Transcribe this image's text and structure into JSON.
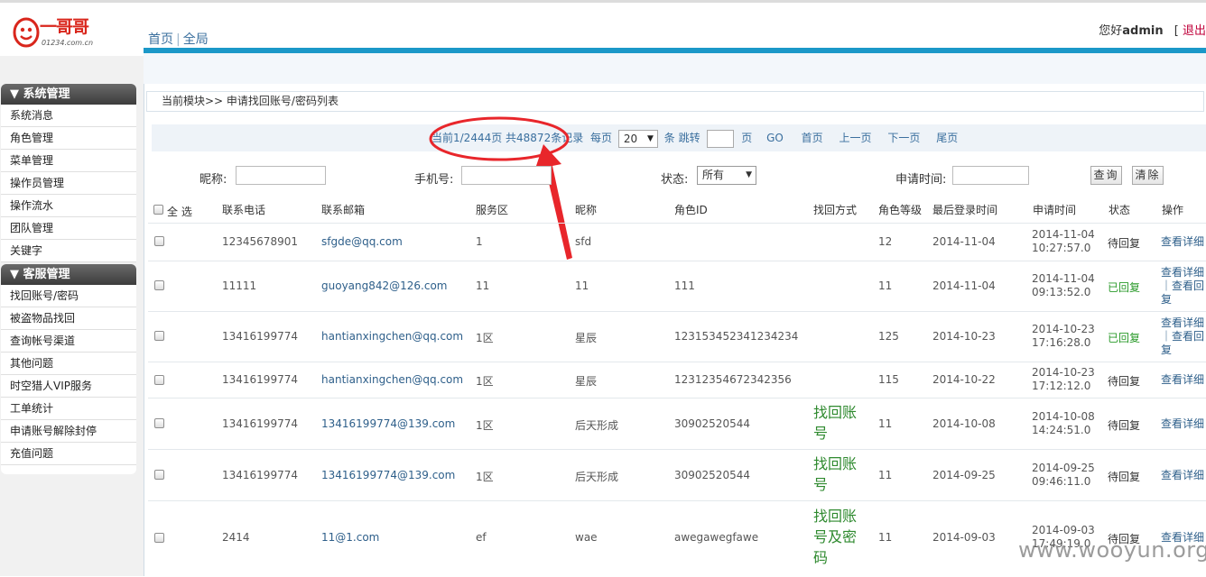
{
  "header": {
    "logo_text": "一哥哥",
    "logo_domain": "01234.com.cn",
    "nav": [
      "首页",
      "全局"
    ],
    "greeting": "您好",
    "username": "admin",
    "bracket": "[",
    "logout": "退出"
  },
  "sidebar": {
    "sections": [
      {
        "title": "▼ 系统管理",
        "items": [
          "系统消息",
          "角色管理",
          "菜单管理",
          "操作员管理",
          "操作流水",
          "团队管理",
          "关键字"
        ]
      },
      {
        "title": "▼ 客服管理",
        "items": [
          "找回账号/密码",
          "被盗物品找回",
          "查询帐号渠道",
          "其他问题",
          "时空猎人VIP服务",
          "工单统计",
          "申请账号解除封停",
          "充值问题"
        ]
      }
    ]
  },
  "breadcrumb": "当前模块>>  申请找回账号/密码列表",
  "pager": {
    "summary": "当前1/2444页 共48872条记录",
    "per_page_label": "每页",
    "per_page_value": "20",
    "unit_label": "条",
    "jump_label": "跳转",
    "page_label": "页",
    "go": "GO",
    "first": "首页",
    "prev": "上一页",
    "next": "下一页",
    "last": "尾页"
  },
  "filters": {
    "nickname_label": "昵称:",
    "phone_label": "手机号:",
    "status_label": "状态:",
    "status_value": "所有",
    "apply_time_label": "申请时间:",
    "query_button": "查询",
    "clear_button": "清除"
  },
  "table": {
    "select_all": "全 选",
    "columns": [
      "联系电话",
      "联系邮箱",
      "服务区",
      "昵称",
      "角色ID",
      "找回方式",
      "角色等级",
      "最后登录时间",
      "申请时间",
      "状态",
      "操作"
    ],
    "rows": [
      {
        "phone": "12345678901",
        "email": "sfgde@qq.com",
        "zone": "1",
        "nickname": "sfd",
        "role_id": "",
        "method": "",
        "level": "12",
        "last_login": "2014-11-04",
        "apply_date": "2014-11-04",
        "apply_time": "10:27:57.0",
        "status": "待回复",
        "status_done": false,
        "op1": "查看详细",
        "op2": ""
      },
      {
        "phone": "11111",
        "email": "guoyang842@126.com",
        "zone": "11",
        "nickname": "11",
        "role_id": "111",
        "method": "",
        "level": "11",
        "last_login": "2014-11-04",
        "apply_date": "2014-11-04",
        "apply_time": "09:13:52.0",
        "status": "已回复",
        "status_done": true,
        "op1": "查看详细",
        "op2": "｜查看回复"
      },
      {
        "phone": "13416199774",
        "email": "hantianxingchen@qq.com",
        "zone": "1区",
        "nickname": "星辰",
        "role_id": "123153452341234234",
        "method": "",
        "level": "125",
        "last_login": "2014-10-23",
        "apply_date": "2014-10-23",
        "apply_time": "17:16:28.0",
        "status": "已回复",
        "status_done": true,
        "op1": "查看详细",
        "op2": "｜查看回复"
      },
      {
        "phone": "13416199774",
        "email": "hantianxingchen@qq.com",
        "zone": "1区",
        "nickname": "星辰",
        "role_id": "12312354672342356",
        "method": "",
        "level": "115",
        "last_login": "2014-10-22",
        "apply_date": "2014-10-23",
        "apply_time": "17:12:12.0",
        "status": "待回复",
        "status_done": false,
        "op1": "查看详细",
        "op2": ""
      },
      {
        "phone": "13416199774",
        "email": "13416199774@139.com",
        "zone": "1区",
        "nickname": "后天形成",
        "role_id": "30902520544",
        "method": "找回账号",
        "level": "11",
        "last_login": "2014-10-08",
        "apply_date": "2014-10-08",
        "apply_time": "14:24:51.0",
        "status": "待回复",
        "status_done": false,
        "op1": "查看详细",
        "op2": ""
      },
      {
        "phone": "13416199774",
        "email": "13416199774@139.com",
        "zone": "1区",
        "nickname": "后天形成",
        "role_id": "30902520544",
        "method": "找回账号",
        "level": "11",
        "last_login": "2014-09-25",
        "apply_date": "2014-09-25",
        "apply_time": "09:46:11.0",
        "status": "待回复",
        "status_done": false,
        "op1": "查看详细",
        "op2": ""
      },
      {
        "phone": "2414",
        "email": "11@1.com",
        "zone": "ef",
        "nickname": "wae",
        "role_id": "awegawegfawe",
        "method": "找回账号及密码",
        "level": "11",
        "last_login": "2014-09-03",
        "apply_date": "2014-09-03",
        "apply_time": "17:49:19.0",
        "status": "待回复",
        "status_done": false,
        "op1": "查看详细",
        "op2": ""
      }
    ]
  },
  "watermark": "www.wooyun.org",
  "colors": {
    "accent_blue": "#1b98c8",
    "link_blue": "#2e5f8a",
    "replied_green": "#2a9a2a",
    "annotation_red": "#e8262b"
  }
}
